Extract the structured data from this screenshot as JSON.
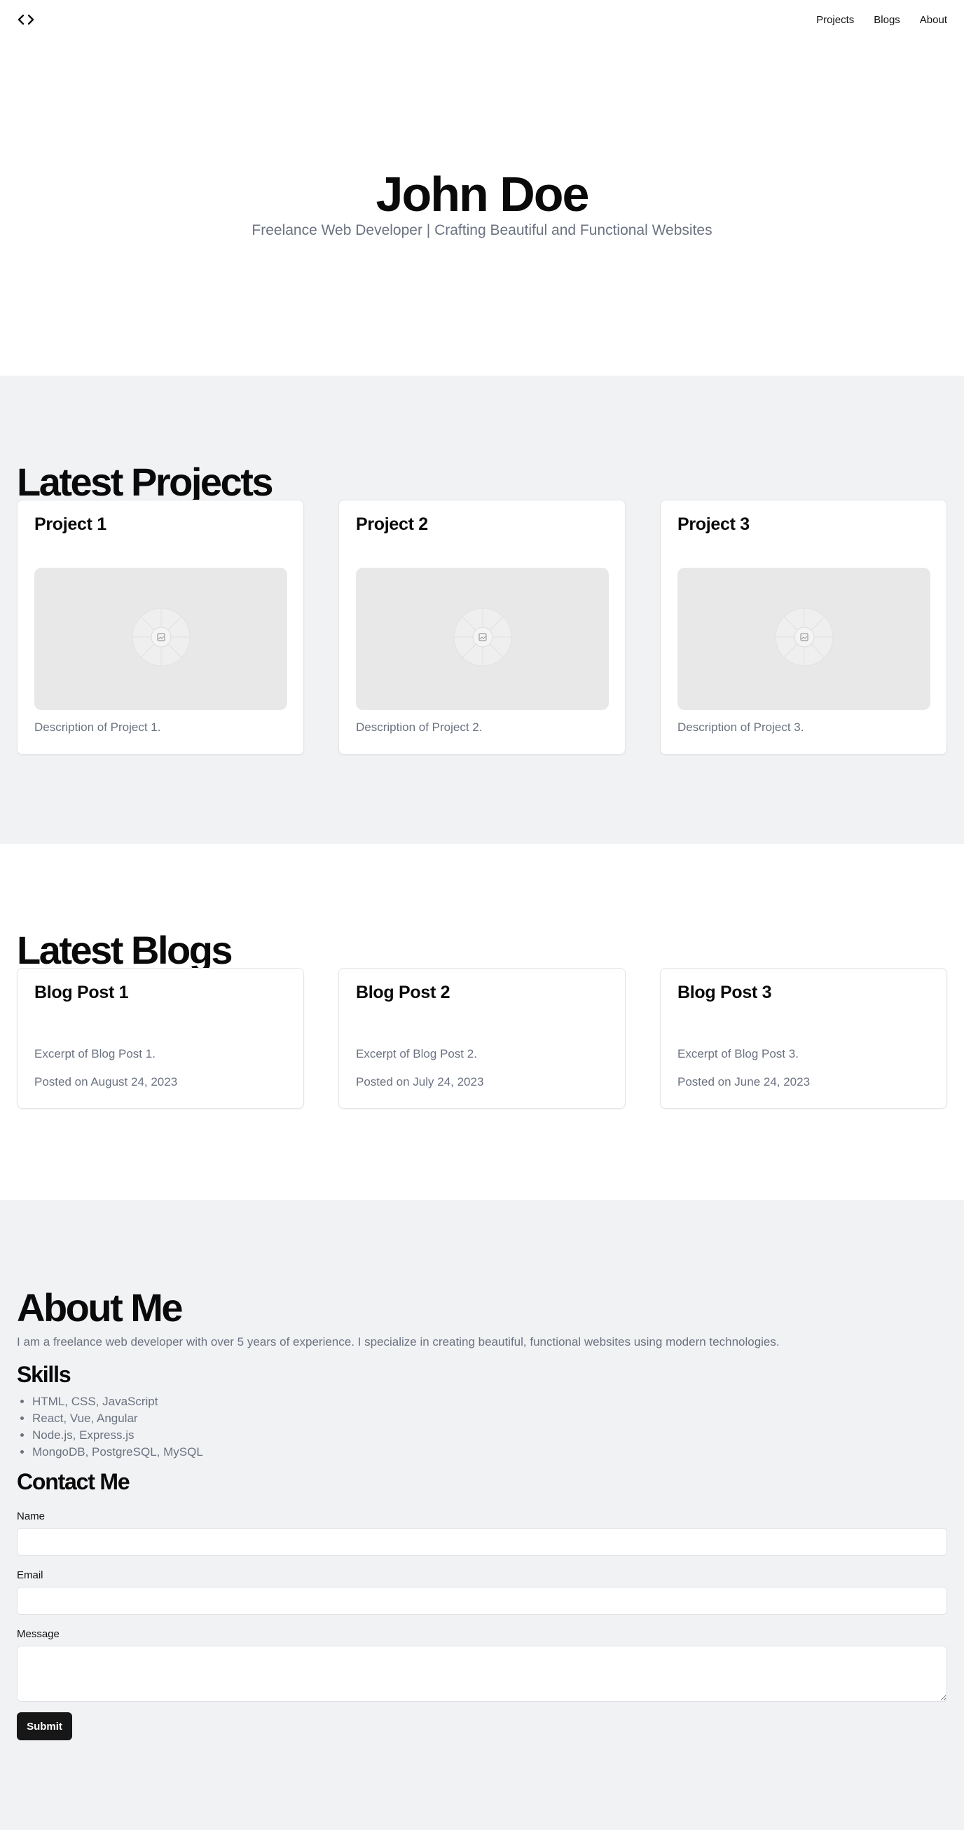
{
  "header": {
    "logo_icon": "code-brackets-icon",
    "nav": [
      {
        "label": "Projects"
      },
      {
        "label": "Blogs"
      },
      {
        "label": "About"
      }
    ]
  },
  "hero": {
    "name": "John Doe",
    "tagline": "Freelance Web Developer | Crafting Beautiful and Functional Websites"
  },
  "projects": {
    "title": "Latest Projects",
    "items": [
      {
        "title": "Project 1",
        "description": "Description of Project 1.",
        "image_icon": "image-placeholder-icon"
      },
      {
        "title": "Project 2",
        "description": "Description of Project 2.",
        "image_icon": "image-placeholder-icon"
      },
      {
        "title": "Project 3",
        "description": "Description of Project 3.",
        "image_icon": "image-placeholder-icon"
      }
    ]
  },
  "blogs": {
    "title": "Latest Blogs",
    "items": [
      {
        "title": "Blog Post 1",
        "excerpt": "Excerpt of Blog Post 1.",
        "date": "Posted on August 24, 2023"
      },
      {
        "title": "Blog Post 2",
        "excerpt": "Excerpt of Blog Post 2.",
        "date": "Posted on July 24, 2023"
      },
      {
        "title": "Blog Post 3",
        "excerpt": "Excerpt of Blog Post 3.",
        "date": "Posted on June 24, 2023"
      }
    ]
  },
  "about": {
    "title": "About Me",
    "text": "I am a freelance web developer with over 5 years of experience. I specialize in creating beautiful, functional websites using modern technologies.",
    "skills_title": "Skills",
    "skills": [
      "HTML, CSS, JavaScript",
      "React, Vue, Angular",
      "Node.js, Express.js",
      "MongoDB, PostgreSQL, MySQL"
    ]
  },
  "contact": {
    "title": "Contact Me",
    "name_label": "Name",
    "name_value": "",
    "email_label": "Email",
    "email_value": "",
    "message_label": "Message",
    "message_value": "",
    "submit_label": "Submit"
  },
  "colors": {
    "text": "#0a0a0a",
    "muted": "#6b7280",
    "section_alt_bg": "#f1f2f4",
    "button_bg": "#171717"
  }
}
